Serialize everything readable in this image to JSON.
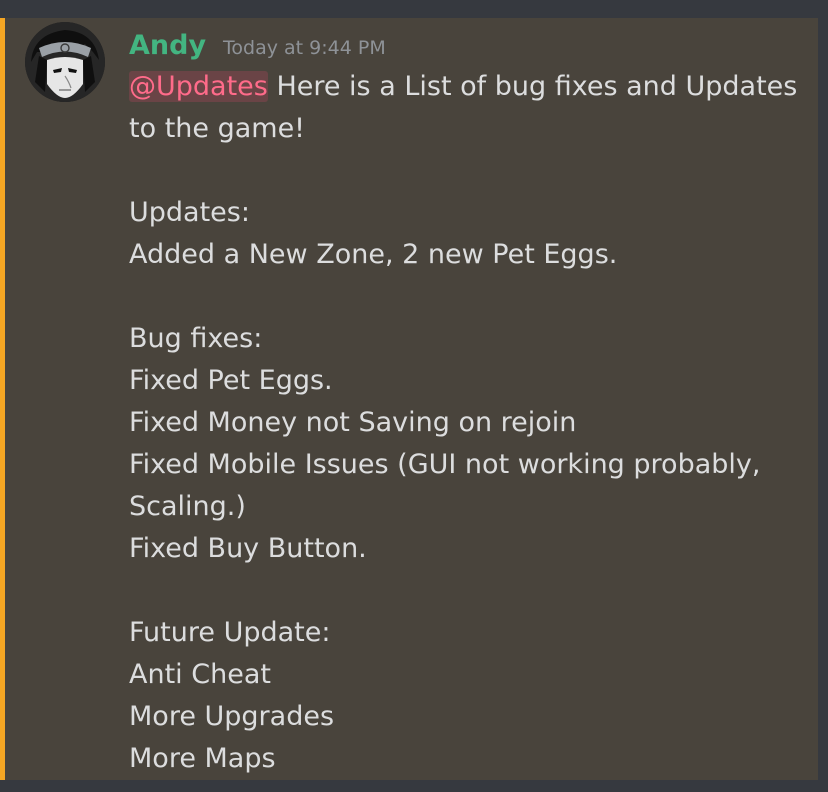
{
  "message": {
    "author": "Andy",
    "timestamp": "Today at 9:44 PM",
    "mention": "@Updates",
    "intro_tail": " Here is a List of bug fixes and Updates",
    "lines": [
      "to the game!",
      "",
      "Updates:",
      "Added a New Zone, 2 new Pet Eggs.",
      "",
      "Bug fixes:",
      "Fixed Pet Eggs.",
      "Fixed Money not Saving on rejoin",
      "Fixed Mobile Issues (GUI not working probably,",
      "Scaling.)",
      "Fixed Buy Button.",
      "",
      "Future Update:",
      "Anti Cheat",
      "More Upgrades",
      "More Maps"
    ]
  },
  "colors": {
    "background": "#36393f",
    "message_highlight": "#49443c",
    "highlight_border": "#f5a623",
    "username": "#43b581",
    "timestamp": "#8e9297",
    "text": "#dcddde",
    "mention": "#ff6b8a"
  },
  "icons": {
    "avatar": "anime-character-avatar"
  }
}
